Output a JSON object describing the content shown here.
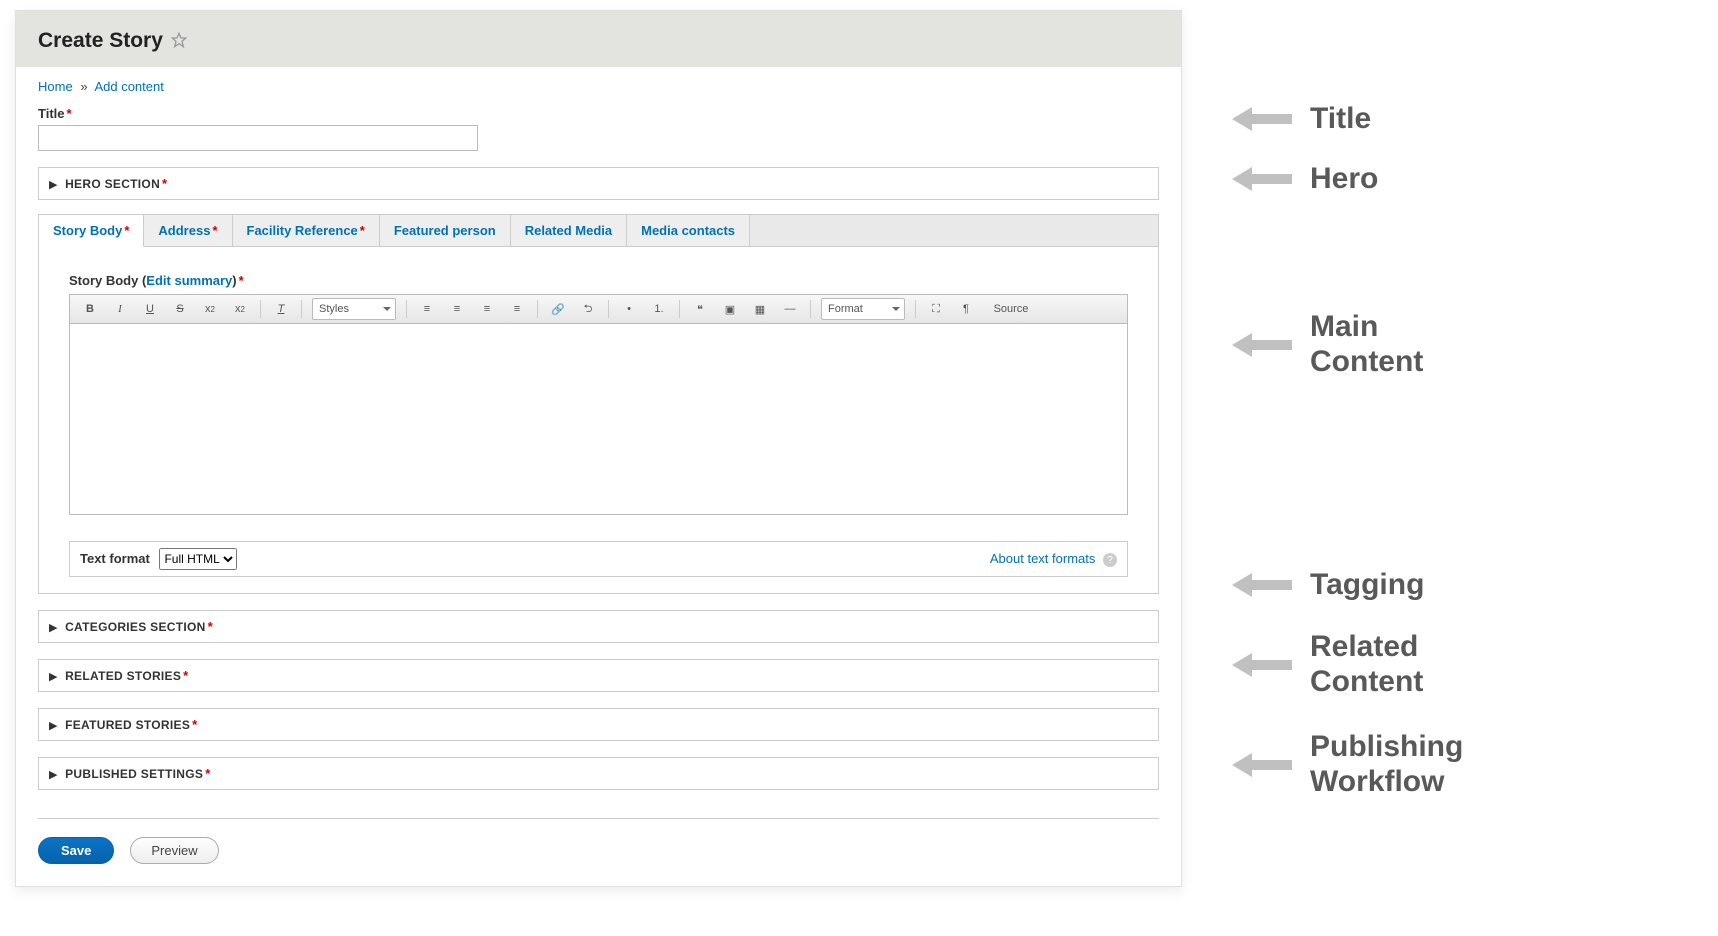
{
  "header": {
    "title": "Create Story"
  },
  "breadcrumb": {
    "home": "Home",
    "sep": "»",
    "add_content": "Add content"
  },
  "fields": {
    "title_label": "Title",
    "hero_label": "HERO SECTION",
    "categories_label": "CATEGORIES SECTION",
    "related_stories_label": "RELATED STORIES",
    "featured_stories_label": "FEATURED STORIES",
    "published_settings_label": "PUBLISHED SETTINGS"
  },
  "tabs": [
    {
      "label": "Story Body",
      "required": true,
      "active": true
    },
    {
      "label": "Address",
      "required": true,
      "active": false
    },
    {
      "label": "Facility Reference",
      "required": true,
      "active": false
    },
    {
      "label": "Featured person",
      "required": false,
      "active": false
    },
    {
      "label": "Related Media",
      "required": false,
      "active": false
    },
    {
      "label": "Media contacts",
      "required": false,
      "active": false
    }
  ],
  "body_field": {
    "label_prefix": "Story Body (",
    "edit_summary": "Edit summary",
    "label_suffix": ")"
  },
  "toolbar": {
    "styles_label": "Styles",
    "format_label": "Format",
    "source_label": "Source",
    "buttons": {
      "bold": "B",
      "italic": "I",
      "underline": "U",
      "strike": "S",
      "sup": "x",
      "sub": "x",
      "removefmt": "T",
      "alignl": "≡",
      "alignc": "≡",
      "alignr": "≡",
      "alignj": "≡",
      "link": "🔗",
      "unlink": "⮌",
      "bullet": "•",
      "number": "1.",
      "quote": "❝",
      "image": "▣",
      "table": "▦",
      "hr": "—",
      "max": "⛶",
      "show": "¶"
    }
  },
  "text_format": {
    "label": "Text format",
    "selected": "Full HTML",
    "about_link": "About text formats"
  },
  "actions": {
    "save": "Save",
    "preview": "Preview"
  },
  "annotations": {
    "title": "Title",
    "hero": "Hero",
    "main": "Main\nContent",
    "tagging": "Tagging",
    "related": "Related\nContent",
    "publishing": "Publishing\nWorkflow"
  }
}
